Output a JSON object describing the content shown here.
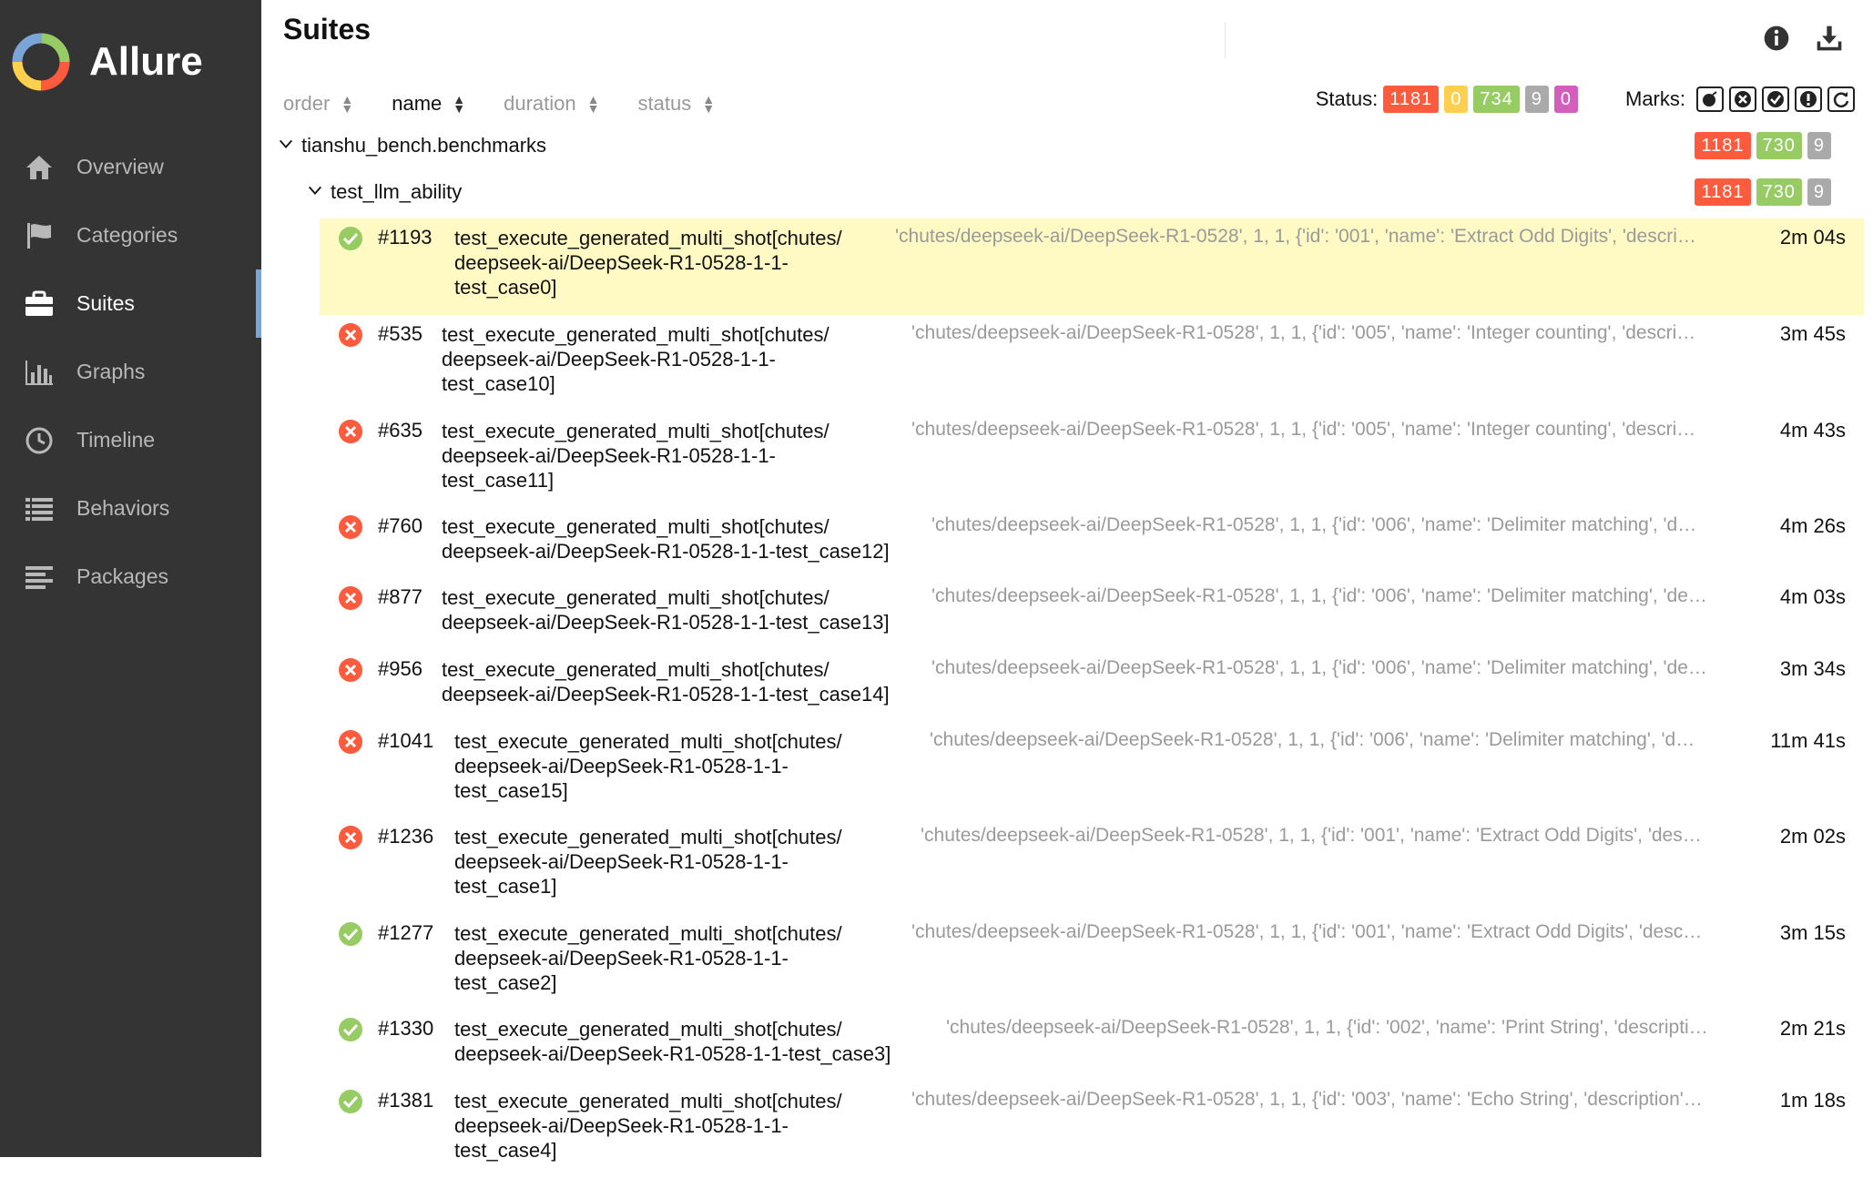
{
  "app": {
    "name": "Allure"
  },
  "sidebar": {
    "items": [
      {
        "label": "Overview",
        "icon": "home-icon"
      },
      {
        "label": "Categories",
        "icon": "flag-icon"
      },
      {
        "label": "Suites",
        "icon": "briefcase-icon",
        "active": true
      },
      {
        "label": "Graphs",
        "icon": "bar-chart-icon"
      },
      {
        "label": "Timeline",
        "icon": "clock-icon"
      },
      {
        "label": "Behaviors",
        "icon": "list-icon"
      },
      {
        "label": "Packages",
        "icon": "align-left-icon"
      }
    ]
  },
  "page": {
    "title": "Suites"
  },
  "sort": {
    "order": "order",
    "name": "name",
    "duration": "duration",
    "status": "status",
    "active": "name"
  },
  "status": {
    "label": "Status:",
    "failed": "1181",
    "broken": "0",
    "passed": "734",
    "skipped": "9",
    "unknown": "0"
  },
  "marks": {
    "label": "Marks:",
    "items": [
      "flaky-mark-icon",
      "new-failed-mark-icon",
      "new-passed-mark-icon",
      "new-broken-mark-icon",
      "retries-mark-icon"
    ]
  },
  "tree": {
    "suite": {
      "name": "tianshu_bench.benchmarks",
      "failed": "1181",
      "passed": "730",
      "skipped": "9"
    },
    "subsuite": {
      "name": "test_llm_ability",
      "failed": "1181",
      "passed": "730",
      "skipped": "9"
    }
  },
  "colors": {
    "failed": "#fd5a3e",
    "broken": "#ffd050",
    "passed": "#97cc64",
    "skipped": "#aaaaaa",
    "unknown": "#d35ebe",
    "sidebar": "#343434",
    "selected": "#fffac4"
  },
  "tests": [
    {
      "status": "passed",
      "num": "#1193",
      "name_lines": [
        "test_execute_generated_multi_shot[chutes/",
        "deepseek-ai/DeepSeek-R1-0528-1-1-",
        "test_case0]"
      ],
      "params": "'chutes/deepseek-ai/DeepSeek-R1-0528', 1, 1, {'id': '001', 'name': 'Extract Odd Digits', 'descri…",
      "duration": "2m 04s"
    },
    {
      "status": "failed",
      "num": "#535",
      "name_lines": [
        "test_execute_generated_multi_shot[chutes/",
        "deepseek-ai/DeepSeek-R1-0528-1-1-",
        "test_case10]"
      ],
      "params": "'chutes/deepseek-ai/DeepSeek-R1-0528', 1, 1, {'id': '005', 'name': 'Integer counting', 'descri…",
      "duration": "3m 45s"
    },
    {
      "status": "failed",
      "num": "#635",
      "name_lines": [
        "test_execute_generated_multi_shot[chutes/",
        "deepseek-ai/DeepSeek-R1-0528-1-1-",
        "test_case11]"
      ],
      "params": "'chutes/deepseek-ai/DeepSeek-R1-0528', 1, 1, {'id': '005', 'name': 'Integer counting', 'descri…",
      "duration": "4m 43s"
    },
    {
      "status": "failed",
      "num": "#760",
      "name_lines": [
        "test_execute_generated_multi_shot[chutes/",
        "deepseek-ai/DeepSeek-R1-0528-1-1-test_case12]"
      ],
      "params": "'chutes/deepseek-ai/DeepSeek-R1-0528', 1, 1, {'id': '006', 'name': 'Delimiter matching', 'd…",
      "duration": "4m 26s"
    },
    {
      "status": "failed",
      "num": "#877",
      "name_lines": [
        "test_execute_generated_multi_shot[chutes/",
        "deepseek-ai/DeepSeek-R1-0528-1-1-test_case13]"
      ],
      "params": "'chutes/deepseek-ai/DeepSeek-R1-0528', 1, 1, {'id': '006', 'name': 'Delimiter matching', 'de…",
      "duration": "4m 03s"
    },
    {
      "status": "failed",
      "num": "#956",
      "name_lines": [
        "test_execute_generated_multi_shot[chutes/",
        "deepseek-ai/DeepSeek-R1-0528-1-1-test_case14]"
      ],
      "params": "'chutes/deepseek-ai/DeepSeek-R1-0528', 1, 1, {'id': '006', 'name': 'Delimiter matching', 'de…",
      "duration": "3m 34s"
    },
    {
      "status": "failed",
      "num": "#1041",
      "name_lines": [
        "test_execute_generated_multi_shot[chutes/",
        "deepseek-ai/DeepSeek-R1-0528-1-1-",
        "test_case15]"
      ],
      "params": "'chutes/deepseek-ai/DeepSeek-R1-0528', 1, 1, {'id': '006', 'name': 'Delimiter matching', 'd…",
      "duration": "11m 41s"
    },
    {
      "status": "failed",
      "num": "#1236",
      "name_lines": [
        "test_execute_generated_multi_shot[chutes/",
        "deepseek-ai/DeepSeek-R1-0528-1-1-",
        "test_case1]"
      ],
      "params": "'chutes/deepseek-ai/DeepSeek-R1-0528', 1, 1, {'id': '001', 'name': 'Extract Odd Digits', 'des…",
      "duration": "2m 02s"
    },
    {
      "status": "passed",
      "num": "#1277",
      "name_lines": [
        "test_execute_generated_multi_shot[chutes/",
        "deepseek-ai/DeepSeek-R1-0528-1-1-",
        "test_case2]"
      ],
      "params": "'chutes/deepseek-ai/DeepSeek-R1-0528', 1, 1, {'id': '001', 'name': 'Extract Odd Digits', 'desc…",
      "duration": "3m 15s"
    },
    {
      "status": "passed",
      "num": "#1330",
      "name_lines": [
        "test_execute_generated_multi_shot[chutes/",
        "deepseek-ai/DeepSeek-R1-0528-1-1-test_case3]"
      ],
      "params": "'chutes/deepseek-ai/DeepSeek-R1-0528', 1, 1, {'id': '002', 'name': 'Print String', 'descripti…",
      "duration": "2m 21s"
    },
    {
      "status": "passed",
      "num": "#1381",
      "name_lines": [
        "test_execute_generated_multi_shot[chutes/",
        "deepseek-ai/DeepSeek-R1-0528-1-1-",
        "test_case4]"
      ],
      "params": "'chutes/deepseek-ai/DeepSeek-R1-0528', 1, 1, {'id': '003', 'name': 'Echo String', 'description'…",
      "duration": "1m 18s"
    }
  ]
}
